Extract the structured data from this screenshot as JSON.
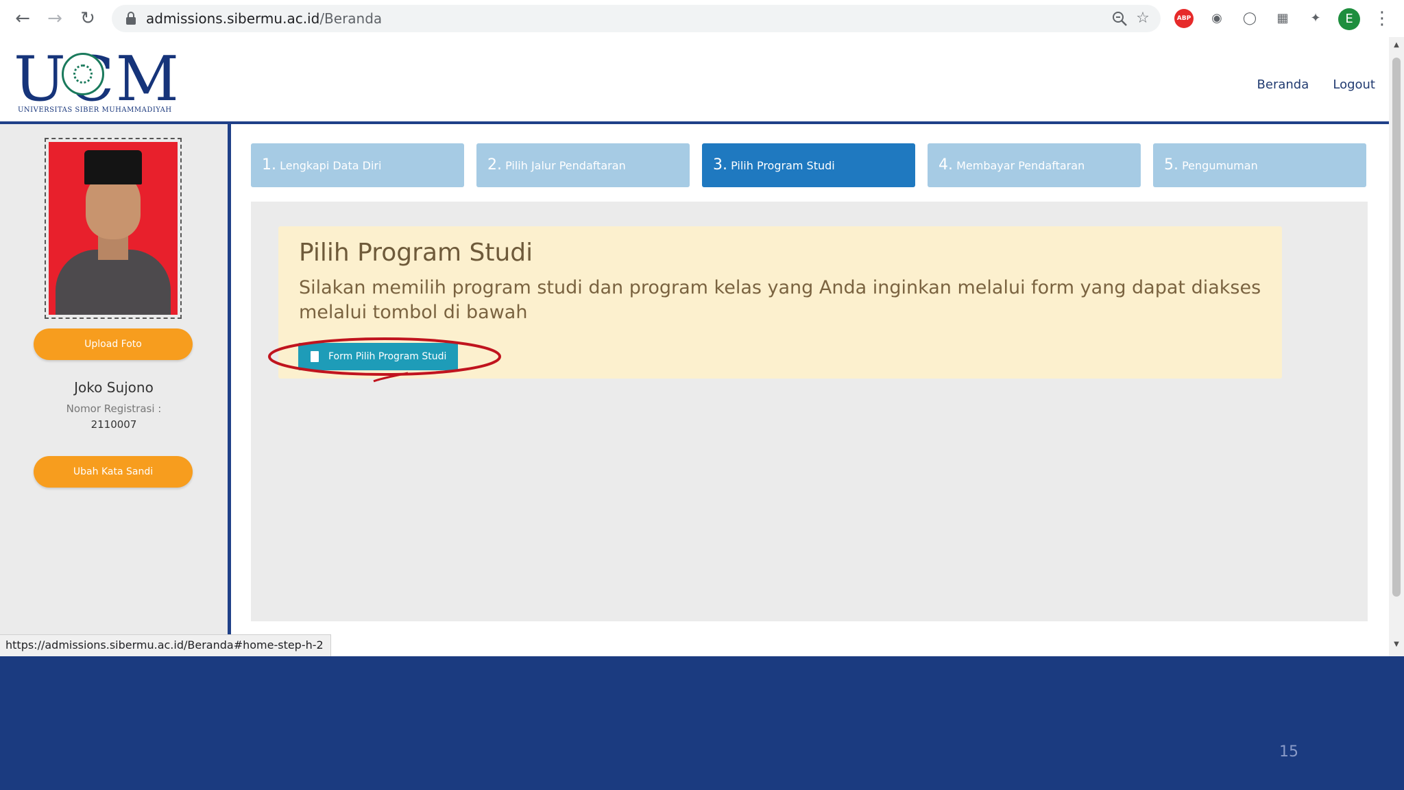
{
  "browser": {
    "url_host": "admissions.sibermu.ac.id",
    "url_path": "/Beranda",
    "status_url": "https://admissions.sibermu.ac.id/Beranda#home-step-h-2",
    "profile_initial": "E",
    "extensions": [
      "abp-icon",
      "camera-icon",
      "sync-icon",
      "extension-grid-icon",
      "puzzle-icon"
    ],
    "abp_label": "ABP"
  },
  "header": {
    "logo_text": "UCM",
    "logo_subtitle": "UNIVERSITAS SIBER MUHAMMADIYAH",
    "nav": [
      {
        "label": "Beranda"
      },
      {
        "label": "Logout"
      }
    ]
  },
  "sidebar": {
    "upload_label": "Upload Foto",
    "user_name": "Joko Sujono",
    "reg_label": "Nomor Registrasi :",
    "reg_number": "2110007",
    "password_label": "Ubah Kata Sandi"
  },
  "steps": [
    {
      "num": "1.",
      "label": "Lengkapi Data Diri",
      "active": false
    },
    {
      "num": "2.",
      "label": "Pilih Jalur Pendaftaran",
      "active": false
    },
    {
      "num": "3.",
      "label": "Pilih Program Studi",
      "active": true
    },
    {
      "num": "4.",
      "label": "Membayar Pendaftaran",
      "active": false
    },
    {
      "num": "5.",
      "label": "Pengumuman",
      "active": false
    }
  ],
  "alert": {
    "title": "Pilih Program Studi",
    "description": "Silakan memilih program studi dan program kelas yang Anda inginkan melalui form yang dapat diakses melalui tombol di bawah",
    "button_label": "Form Pilih Program Studi"
  },
  "slide_number": "15",
  "colors": {
    "brand_blue": "#1f4088",
    "step_active": "#1f79c0",
    "step_inactive": "#a6cbe4",
    "orange_button": "#f79d1e",
    "teal_button": "#1e9cb8",
    "alert_bg": "#fcf0ce",
    "annotation_red": "#c0141e"
  }
}
